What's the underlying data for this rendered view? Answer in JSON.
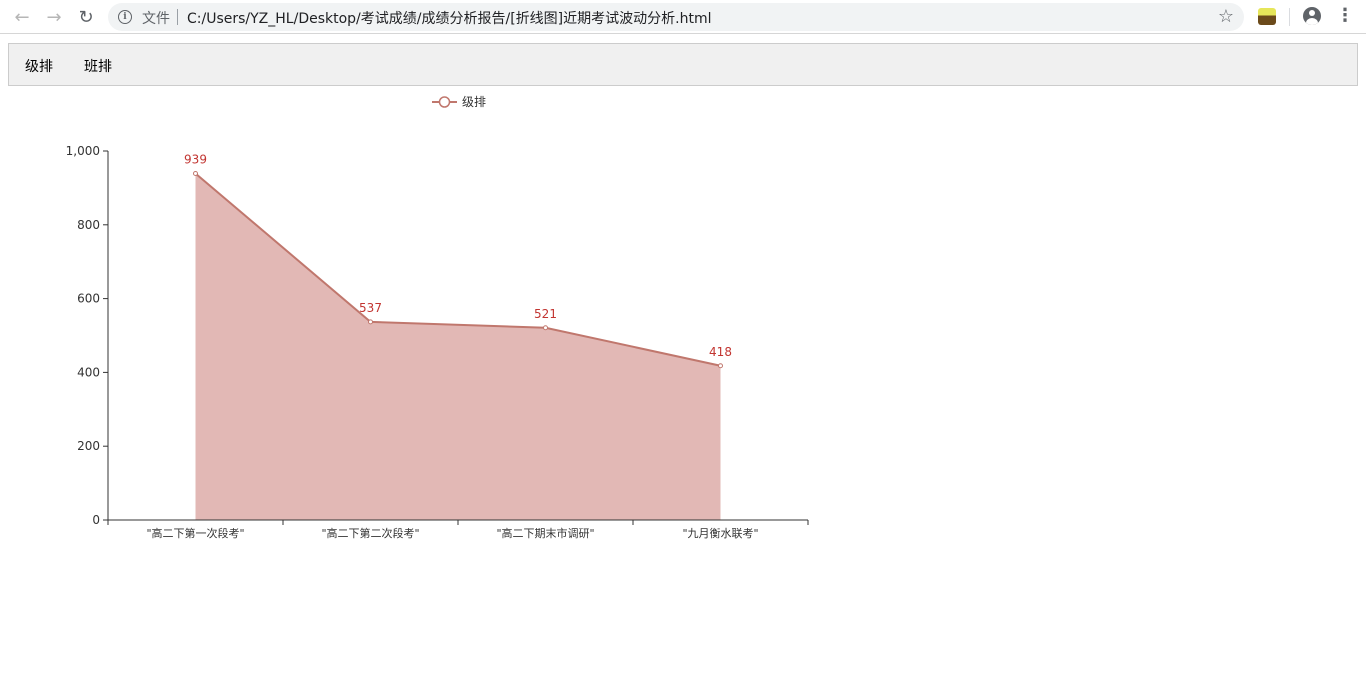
{
  "browser": {
    "scheme_label": "文件",
    "url": "C:/Users/YZ_HL/Desktop/考试成绩/成绩分析报告/[折线图]近期考试波动分析.html"
  },
  "nav": {
    "links": [
      "级排",
      "班排"
    ]
  },
  "colors": {
    "series_line": "#c0776d",
    "series_area": "#e2b8b5",
    "label": "#c23531",
    "axis": "#333333"
  },
  "chart_data": {
    "type": "area",
    "categories": [
      "\"高二下第一次段考\"",
      "\"高二下第二次段考\"",
      "\"高二下期末市调研\"",
      "\"九月衡水联考\""
    ],
    "series": [
      {
        "name": "级排",
        "values": [
          939,
          537,
          521,
          418
        ]
      }
    ],
    "y_ticks": [
      "0",
      "200",
      "400",
      "600",
      "800",
      "1,000"
    ],
    "ylim": [
      0,
      1000
    ],
    "legend_position": "top-center",
    "grid": false
  }
}
